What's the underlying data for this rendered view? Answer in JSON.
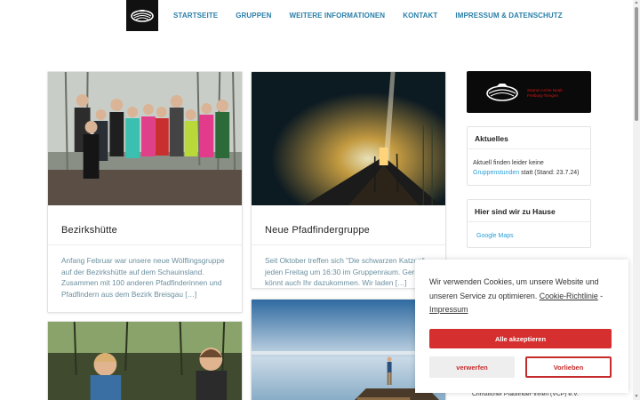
{
  "nav": {
    "items": [
      {
        "label": "STARTSEITE"
      },
      {
        "label": "GRUPPEN"
      },
      {
        "label": "WEITERE INFORMATIONEN"
      },
      {
        "label": "KONTAKT"
      },
      {
        "label": "IMPRESSUM & DATENSCHUTZ"
      }
    ]
  },
  "posts": [
    {
      "title": "Bezirkshütte",
      "excerpt": "Anfang Februar war unsere neue Wölflingsgruppe auf der Bezirkshütte auf dem Schauinsland.  Zusammen mit 100 anderen Pfadfinderinnen und Pfadfindern aus dem Bezirk Breisgau […]"
    },
    {
      "title": "Neue Pfadfindergruppe",
      "excerpt": "Seit Oktober treffen sich \"Die schwarzen Katzen\" jeden Freitag um 16:30 im Gruppenraum. Gerne könnt auch Ihr dazukommen. Wir laden […]"
    }
  ],
  "sidebar": {
    "logo_text_line1": "Stamm Arche Noah",
    "logo_text_line2": "Freiburg-Tiengen",
    "aktuelles_title": "Aktuelles",
    "aktuelles_text_before": "Aktuell finden leider keine ",
    "aktuelles_link": "Gruppenstunden",
    "aktuelles_text_after": " statt (Stand: 23.7.24)",
    "location_title": "Hier sind wir zu Hause",
    "location_link": "Google Maps",
    "footer_text": "Christlicher Pfadfinder*innen (VCP) e.V."
  },
  "cookie": {
    "message": "Wir verwenden Cookies, um unsere Website und unseren Service zu optimieren.",
    "policy_link": "Cookie-Richtlinie",
    "separator": " - ",
    "imprint_link": "Impressum",
    "accept_label": "Alle akzeptieren",
    "deny_label": "verwerfen",
    "prefs_label": "Vorlieben"
  },
  "colors": {
    "accent": "#2a7fa8",
    "brand_red": "#d62f2f"
  }
}
